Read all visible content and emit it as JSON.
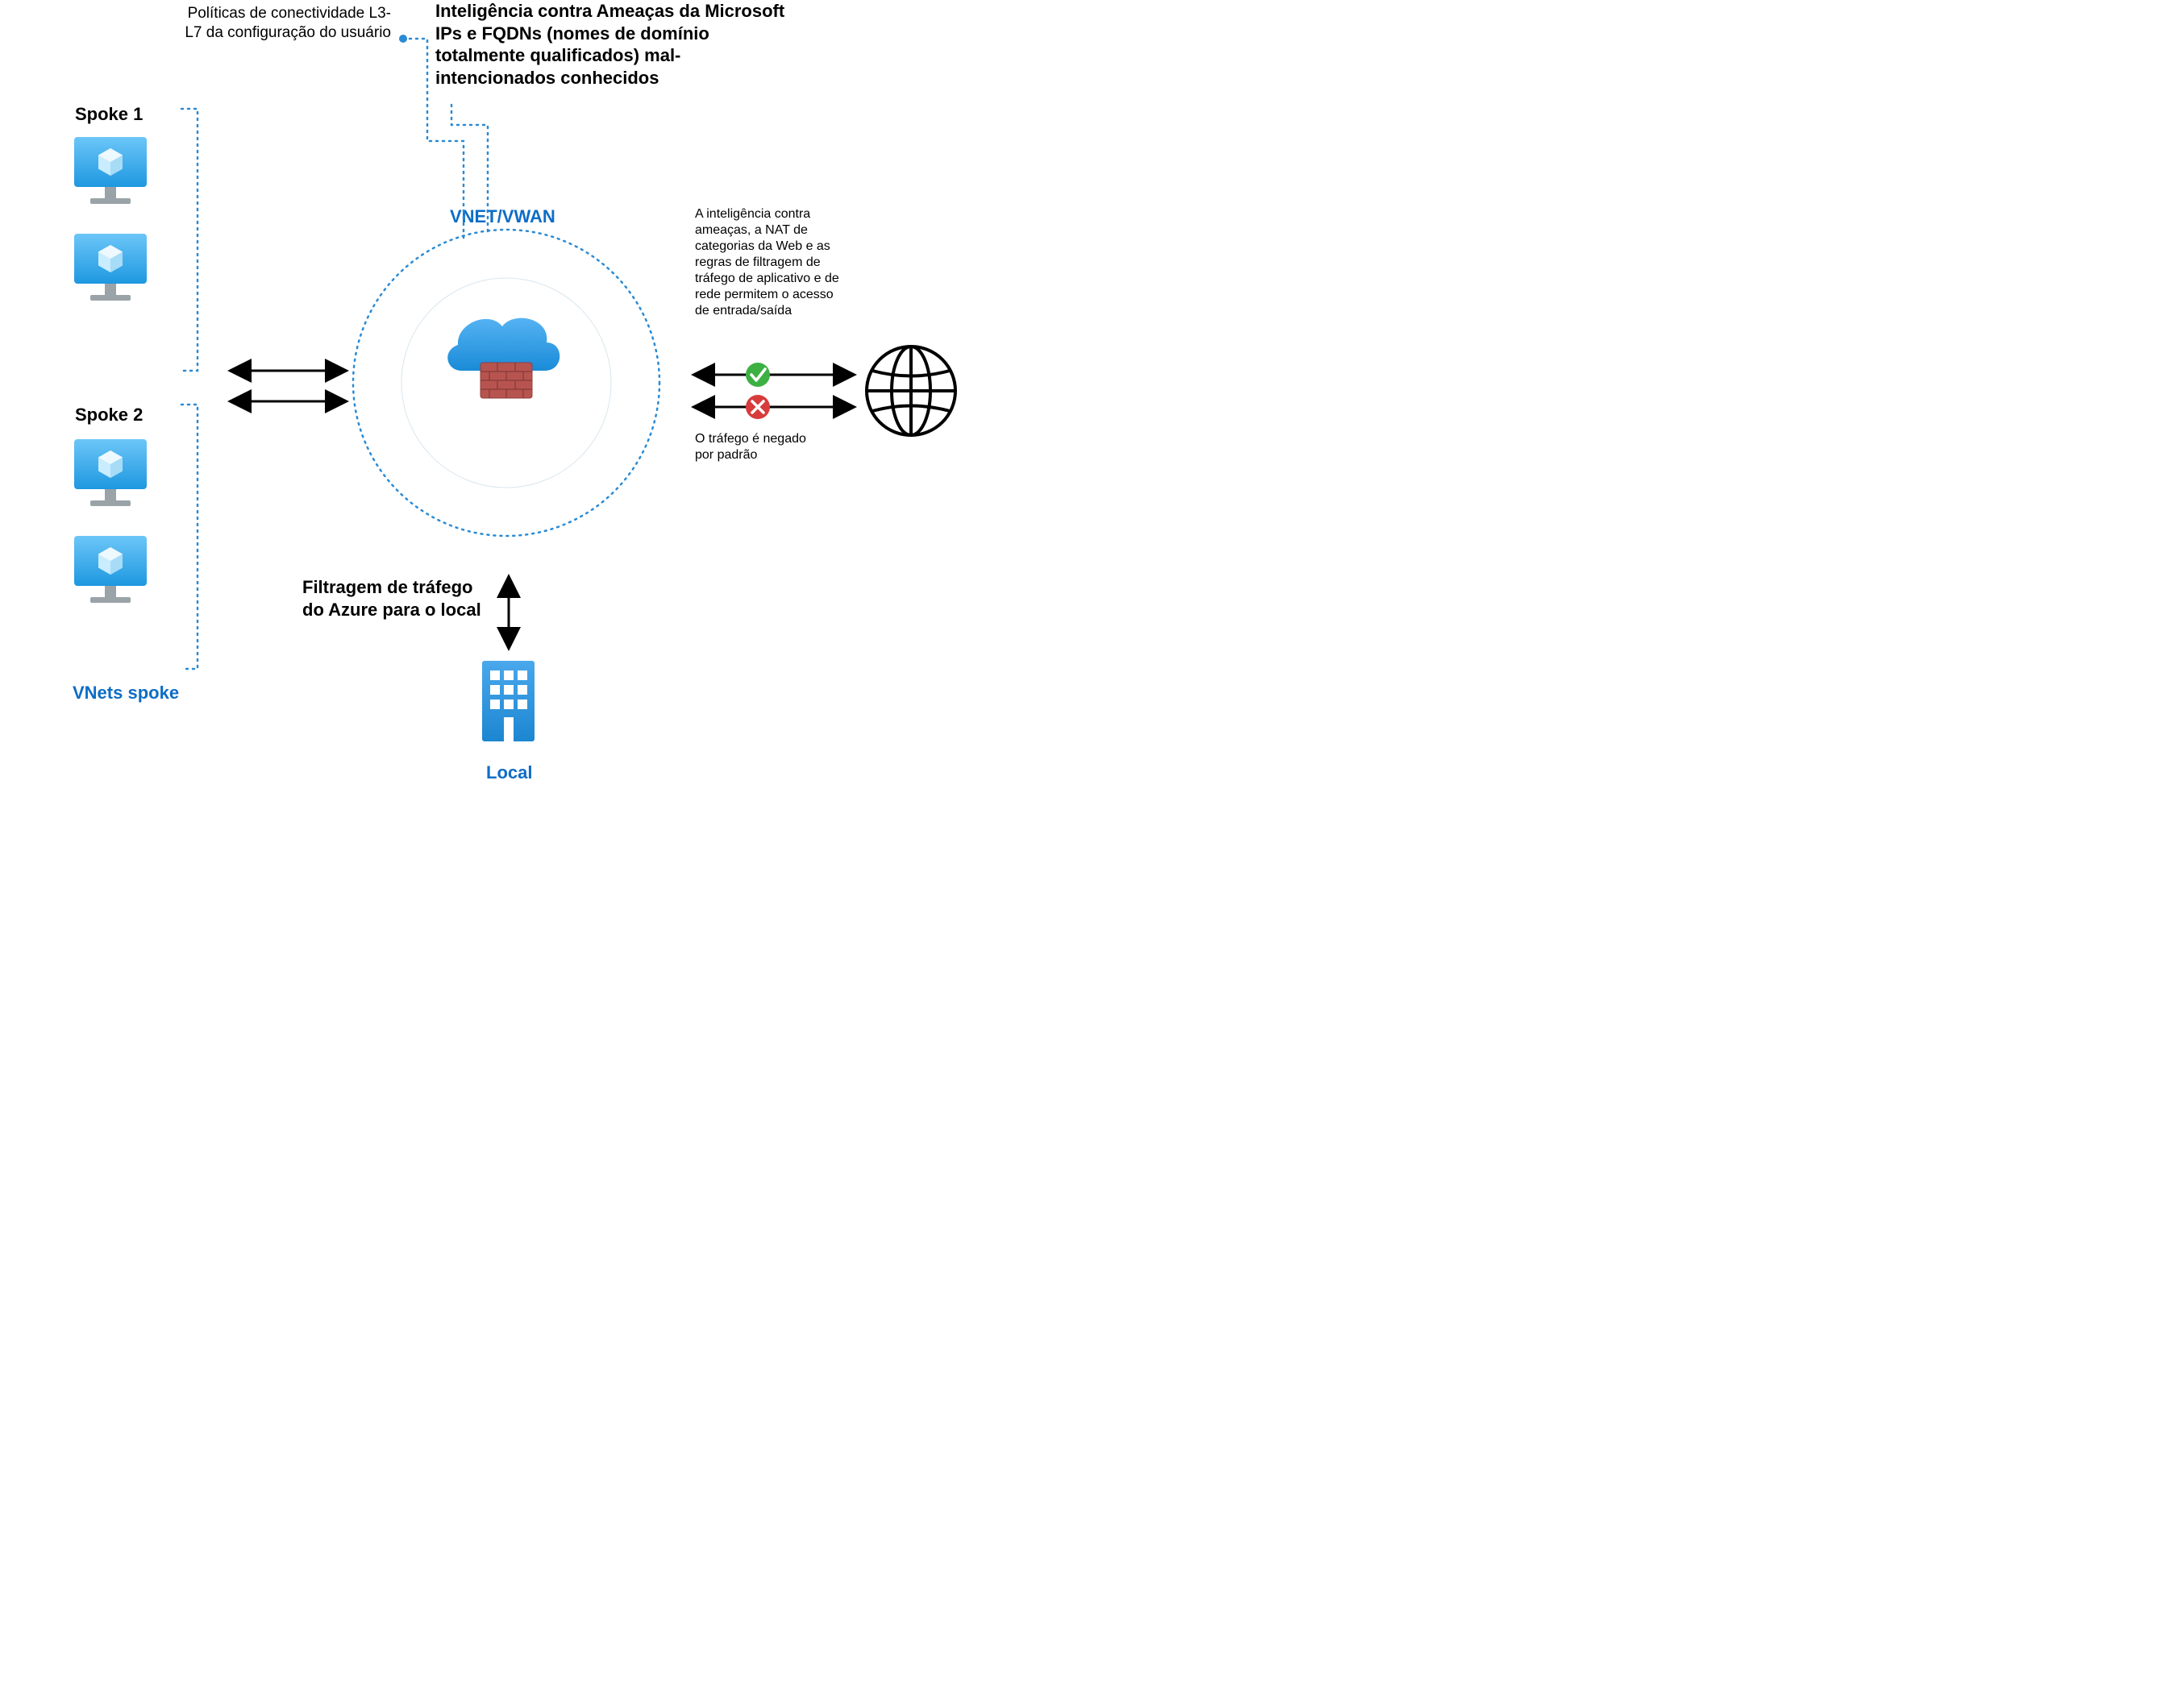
{
  "colors": {
    "azure_blue": "#0d6dc5",
    "dotted_blue": "#2a8ad4",
    "black": "#000000",
    "icon_blue_light": "#50b0f4",
    "icon_blue_dark": "#108bde",
    "brick_red": "#b85450",
    "brick_red_dark": "#a7433f",
    "green": "#3cb043",
    "red": "#d83b3b",
    "gray": "#9aa3a7"
  },
  "labels": {
    "policies": "Políticas de conectividade L3-L7 da configuração do usuário",
    "threat_intel_title": "Inteligência contra Ameaças da Microsoft IPs e FQDNs (nomes de domínio totalmente qualificados) mal-intencionados conhecidos",
    "spoke1": "Spoke 1",
    "spoke2": "Spoke 2",
    "vnets_spoke": "VNets spoke",
    "vnet_vwan": "VNET/VWAN",
    "firewall": "Firewall do Azure",
    "filtering": "Filtragem de tráfego do Azure para o local",
    "local": "Local",
    "allow_text": "A inteligência contra ameaças, a NAT de categorias da Web e as regras de filtragem de tráfego de aplicativo e de rede permitem o acesso de entrada/saída",
    "deny_text": "O tráfego é negado por padrão"
  },
  "icons": {
    "vm": "azure-vm-icon",
    "firewall": "azure-firewall-icon",
    "building": "building-icon",
    "globe": "globe-icon",
    "check": "check-icon",
    "cross": "cross-icon"
  }
}
